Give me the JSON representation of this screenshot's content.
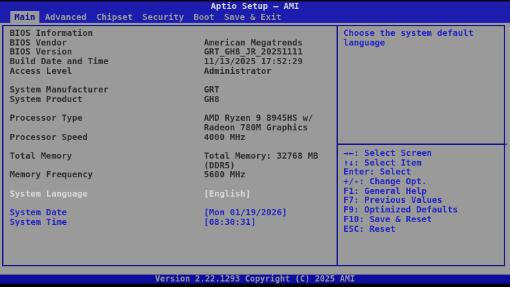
{
  "titlebar": {
    "title": "Aptio Setup – AMI"
  },
  "tabs": [
    {
      "label": "Main",
      "selected": true
    },
    {
      "label": "Advanced",
      "selected": false
    },
    {
      "label": "Chipset",
      "selected": false
    },
    {
      "label": "Security",
      "selected": false
    },
    {
      "label": "Boot",
      "selected": false
    },
    {
      "label": "Save & Exit",
      "selected": false
    }
  ],
  "main": {
    "rows": [
      {
        "name": "bios-information-heading",
        "label": "BIOS Information",
        "value": "",
        "style": "info"
      },
      {
        "name": "bios-vendor-row",
        "label": "BIOS Vendor",
        "value": "American Megatrends",
        "style": "info"
      },
      {
        "name": "bios-version-row",
        "label": "BIOS Version",
        "value": "GRT_GH8_JR_20251111",
        "style": "info"
      },
      {
        "name": "build-date-row",
        "label": "Build Date and Time",
        "value": "11/13/2025 17:52:29",
        "style": "info"
      },
      {
        "name": "access-level-row",
        "label": "Access Level",
        "value": "Administrator",
        "style": "info"
      },
      {
        "spacer": true
      },
      {
        "name": "system-manufacturer-row",
        "label": "System Manufacturer",
        "value": "GRT",
        "style": "info"
      },
      {
        "name": "system-product-row",
        "label": "System Product",
        "value": "GH8",
        "style": "info"
      },
      {
        "spacer": true
      },
      {
        "name": "processor-type-row",
        "label": "Processor Type",
        "value": "AMD Ryzen 9 8945HS w/",
        "style": "info"
      },
      {
        "name": "processor-type-row-cont",
        "label": "",
        "value": "Radeon 780M Graphics",
        "style": "info"
      },
      {
        "name": "processor-speed-row",
        "label": "Processor Speed",
        "value": "4000 MHz",
        "style": "info"
      },
      {
        "spacer": true
      },
      {
        "name": "total-memory-row",
        "label": "Total Memory",
        "value": "Total Memory: 32768 MB",
        "style": "info"
      },
      {
        "name": "total-memory-row-cont",
        "label": "",
        "value": "(DDR5)",
        "style": "info"
      },
      {
        "name": "memory-frequency-row",
        "label": "Memory Frequency",
        "value": "5600 MHz",
        "style": "info"
      },
      {
        "spacer": true
      },
      {
        "name": "system-language-row",
        "label": "System Language",
        "value": "[English]",
        "style": "selected"
      },
      {
        "spacer": true
      },
      {
        "name": "system-date-row",
        "label": "System Date",
        "value": "[Mon 01/19/2026]",
        "style": "editable"
      },
      {
        "name": "system-time-row",
        "label": "System Time",
        "value": "[08:30:31]",
        "style": "editable"
      }
    ]
  },
  "help": {
    "lines": [
      "Choose the system default",
      "language"
    ],
    "keys": [
      "→←: Select Screen",
      "↑↓: Select Item",
      "Enter: Select",
      "+/-: Change Opt.",
      "F1: General Help",
      "F7: Previous Values",
      "F9: Optimized Defaults",
      "F10: Save & Reset",
      "ESC: Reset"
    ]
  },
  "footer": {
    "version_text": "Version 2.22.1293 Copyright (C) 2025 AMI"
  },
  "colors": {
    "header_blue": "#1c1cae",
    "footer_blue": "#0d0d9e",
    "panel_gray": "#9a9a9a",
    "border_navy": "#15158e",
    "info_text": "#303030",
    "item_blue": "#2424c4",
    "selected_text": "#d8d8d8",
    "muted_gray": "#9a9a9a",
    "title_text": "#d4d4d4"
  }
}
